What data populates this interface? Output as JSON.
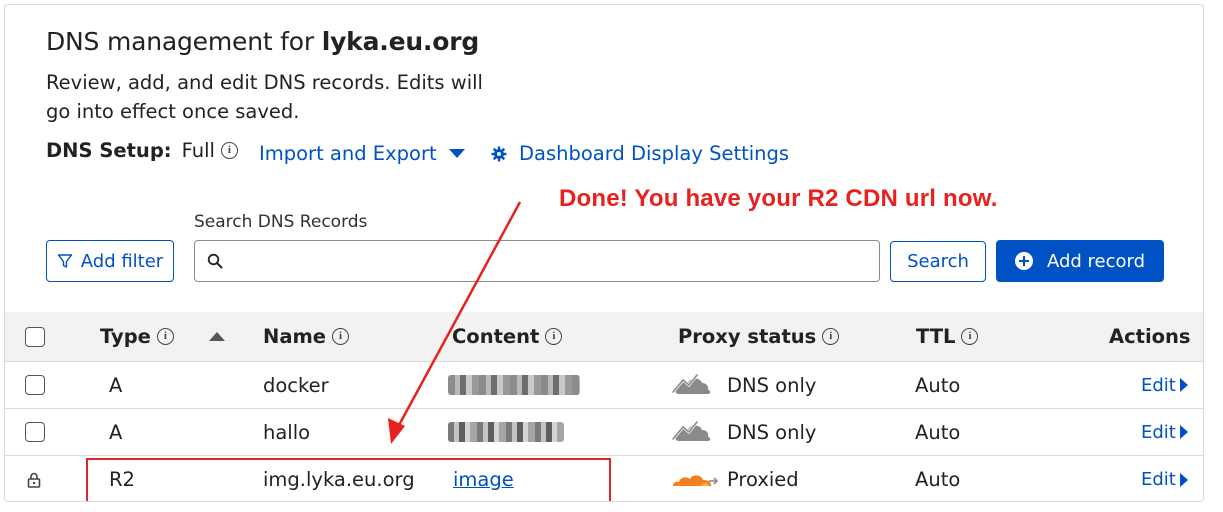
{
  "header": {
    "title_prefix": "DNS management for",
    "domain": "lyka.eu.org",
    "description": "Review, add, and edit DNS records. Edits will go into effect once saved.",
    "setup_label": "DNS Setup:",
    "setup_value": "Full",
    "import_export": "Import and Export",
    "dashboard_settings": "Dashboard Display Settings"
  },
  "annotation": {
    "text": "Done! You have your R2 CDN url now.",
    "color": "#e8211f"
  },
  "toolbar": {
    "add_filter": "Add filter",
    "search_label": "Search DNS Records",
    "search_value": "",
    "search_button": "Search",
    "add_record": "Add record"
  },
  "table": {
    "columns": {
      "type": "Type",
      "name": "Name",
      "content": "Content",
      "proxy_status": "Proxy status",
      "ttl": "TTL",
      "actions": "Actions"
    },
    "rows": [
      {
        "type": "A",
        "name": "docker",
        "content": "",
        "proxy": "DNS only",
        "ttl": "Auto",
        "action": "Edit"
      },
      {
        "type": "A",
        "name": "hallo",
        "content": "",
        "proxy": "DNS only",
        "ttl": "Auto",
        "action": "Edit"
      },
      {
        "type": "R2",
        "name": "img.lyka.eu.org",
        "content": "image",
        "proxy": "Proxied",
        "ttl": "Auto",
        "action": "Edit"
      }
    ]
  },
  "icons": {
    "filter": "filter-icon",
    "search": "search-icon",
    "gear": "gear-icon",
    "plus": "plus-circle-icon",
    "lock": "lock-icon",
    "cloud_gray": "cloud-dns-only-icon",
    "cloud_orange": "cloud-proxied-icon"
  },
  "colors": {
    "accent": "#0051c3",
    "proxied": "#f38020",
    "dns_only": "#8a8a8a",
    "highlight": "#d9252c"
  }
}
